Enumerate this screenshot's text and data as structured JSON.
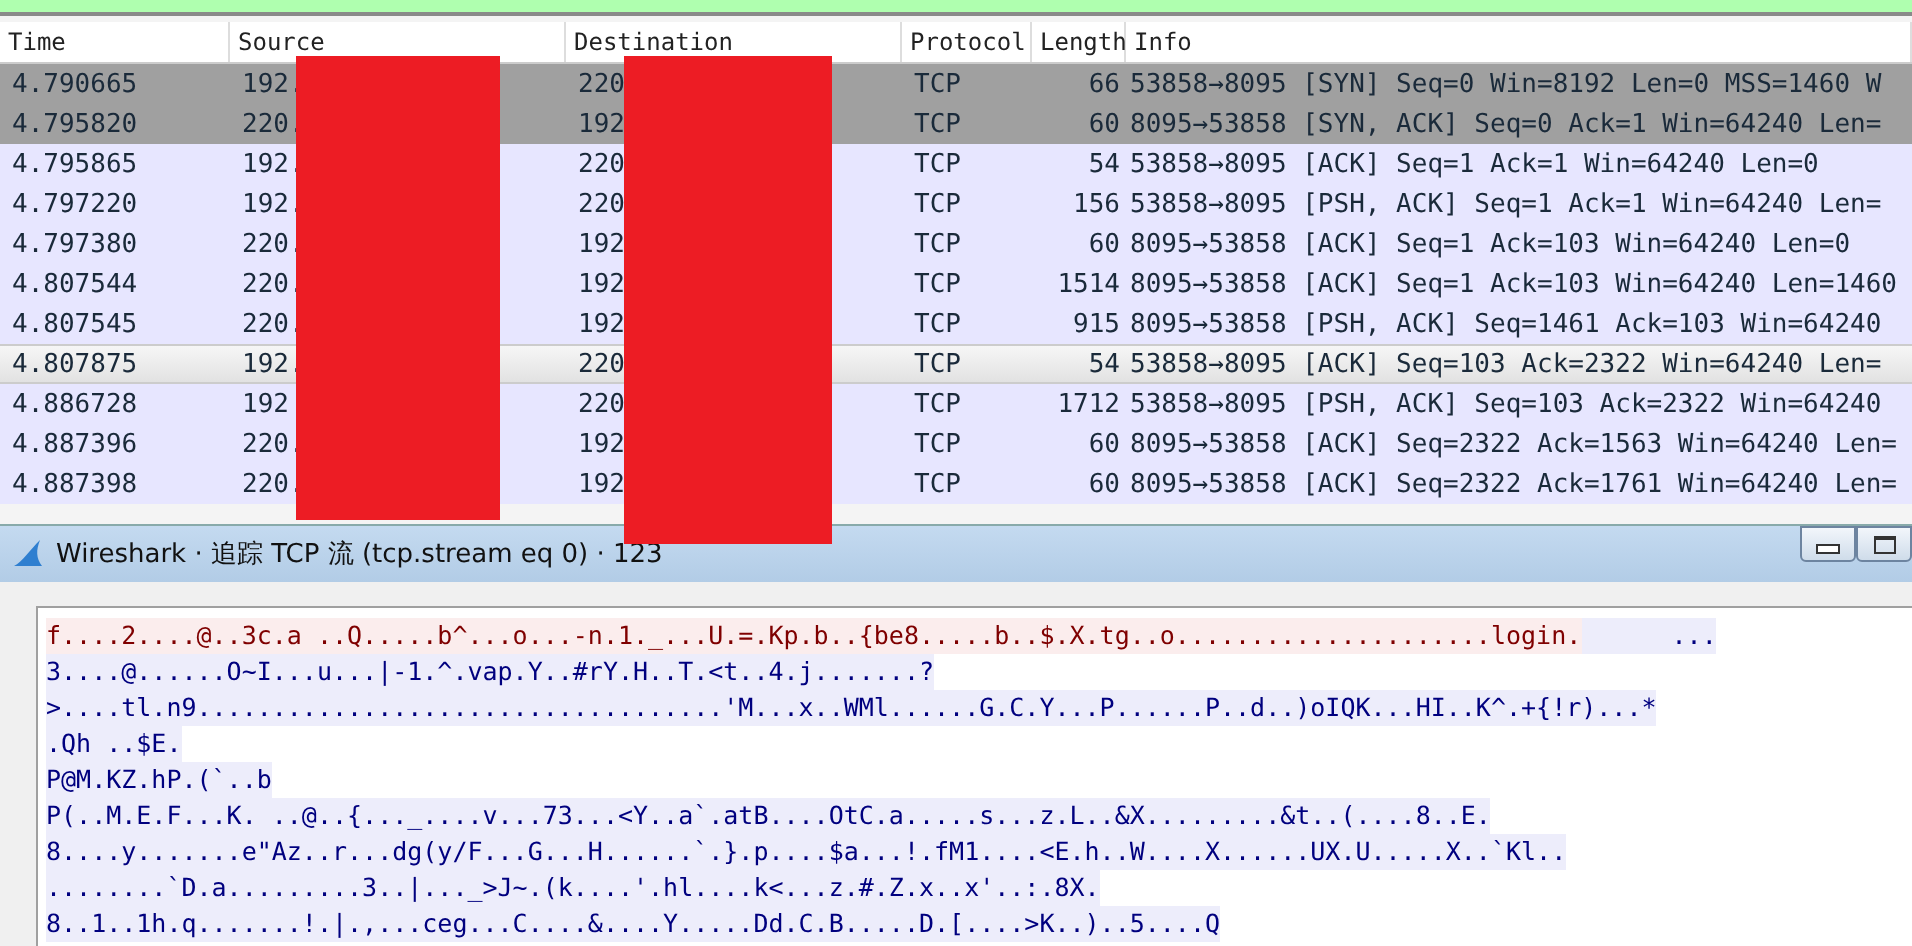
{
  "packet_list": {
    "columns": [
      "Time",
      "Source",
      "Destination",
      "Protocol",
      "Length",
      "Info"
    ],
    "rows": [
      {
        "time": "4.790665",
        "source": "192.",
        "destination": "220",
        "protocol": "TCP",
        "length": "66",
        "info": "53858→8095 [SYN] Seq=0 Win=8192 Len=0 MSS=1460 W",
        "color": "#a0a0a0",
        "selected": false
      },
      {
        "time": "4.795820",
        "source": "220.",
        "destination": "192",
        "protocol": "TCP",
        "length": "60",
        "info": "8095→53858 [SYN, ACK] Seq=0 Ack=1 Win=64240 Len=",
        "color": "#a0a0a0",
        "selected": false
      },
      {
        "time": "4.795865",
        "source": "192.",
        "destination": "220",
        "protocol": "TCP",
        "length": "54",
        "info": "53858→8095 [ACK] Seq=1 Ack=1 Win=64240 Len=0",
        "color": "#e7e6ff",
        "selected": false
      },
      {
        "time": "4.797220",
        "source": "192.",
        "destination": "220",
        "protocol": "TCP",
        "length": "156",
        "info": "53858→8095 [PSH, ACK] Seq=1 Ack=1 Win=64240 Len=",
        "color": "#e7e6ff",
        "selected": false
      },
      {
        "time": "4.797380",
        "source": "220.",
        "destination": "192",
        "protocol": "TCP",
        "length": "60",
        "info": "8095→53858 [ACK] Seq=1 Ack=103 Win=64240 Len=0",
        "color": "#e7e6ff",
        "selected": false
      },
      {
        "time": "4.807544",
        "source": "220.",
        "destination": "192",
        "protocol": "TCP",
        "length": "1514",
        "info": "8095→53858 [ACK] Seq=1 Ack=103 Win=64240 Len=1460",
        "color": "#e7e6ff",
        "selected": false
      },
      {
        "time": "4.807545",
        "source": "220.",
        "destination": "192",
        "protocol": "TCP",
        "length": "915",
        "info": "8095→53858 [PSH, ACK] Seq=1461 Ack=103 Win=64240",
        "color": "#e7e6ff",
        "selected": false
      },
      {
        "time": "4.807875",
        "source": "192.",
        "destination": "220",
        "protocol": "TCP",
        "length": "54",
        "info": "53858→8095 [ACK] Seq=103 Ack=2322 Win=64240 Len=",
        "selected": true
      },
      {
        "time": "4.886728",
        "source": "192",
        "destination": "220",
        "protocol": "TCP",
        "length": "1712",
        "info": "53858→8095 [PSH, ACK] Seq=103 Ack=2322 Win=64240",
        "color": "#e7e6ff",
        "selected": false
      },
      {
        "time": "4.887396",
        "source": "220.",
        "destination": "192",
        "protocol": "TCP",
        "length": "60",
        "info": "8095→53858 [ACK] Seq=2322 Ack=1563 Win=64240 Len=",
        "color": "#e7e6ff",
        "selected": false
      },
      {
        "time": "4.887398",
        "source": "220.",
        "destination": "192",
        "protocol": "TCP",
        "length": "60",
        "info": "8095→53858 [ACK] Seq=2322 Ack=1761 Win=64240 Len=",
        "color": "#e7e6ff",
        "selected": false
      }
    ]
  },
  "stream_window": {
    "title": "Wireshark · 追踪 TCP 流 (tcp.stream eq 0) · 123",
    "lines": [
      [
        {
          "kind": "client",
          "text": "f....2....@..3c.a ..Q.....b^...o...-n.1._...U.=.Kp.b..{be8.....b..$.X.tg..o.....................login."
        },
        {
          "kind": "server",
          "text": "      ..."
        }
      ],
      [
        {
          "kind": "server",
          "text": "3....@......O~I...u...|-1.^.vap.Y..#rY.H..T.<t..4.j.......?"
        }
      ],
      [
        {
          "kind": "server",
          "text": ">....tl.n9...................................'M...x..WMl......G.C.Y...P......P..d..)oIQK...HI..K^.+{!r)...*"
        }
      ],
      [
        {
          "kind": "server",
          "text": ".Qh ..$E."
        }
      ],
      [
        {
          "kind": "server",
          "text": "P@M.KZ.hP.(`..b"
        }
      ],
      [
        {
          "kind": "server",
          "text": "P(..M.E.F...K. ..@..{..._....v...73...<Y..a`.atB....OtC.a.....s...z.L..&X.........&t..(....8..E."
        }
      ],
      [
        {
          "kind": "server",
          "text": "8....y.......e\"Az..r...dg(y/F...G...H......`.}.p....$a...!.fM1....<E.h..W....X......UX.U.....X..`Kl.."
        }
      ],
      [
        {
          "kind": "server",
          "text": "........`D.a.........3..|..._>J~.(k....'.hl....k<...z.#.Z.x..x'..:.8X."
        }
      ],
      [
        {
          "kind": "server",
          "text": "8..1..1h.q.......!.|.,...ceg...C....&....Y.....Dd.C.B.....D.[....>K..)..5....Q"
        }
      ]
    ]
  }
}
